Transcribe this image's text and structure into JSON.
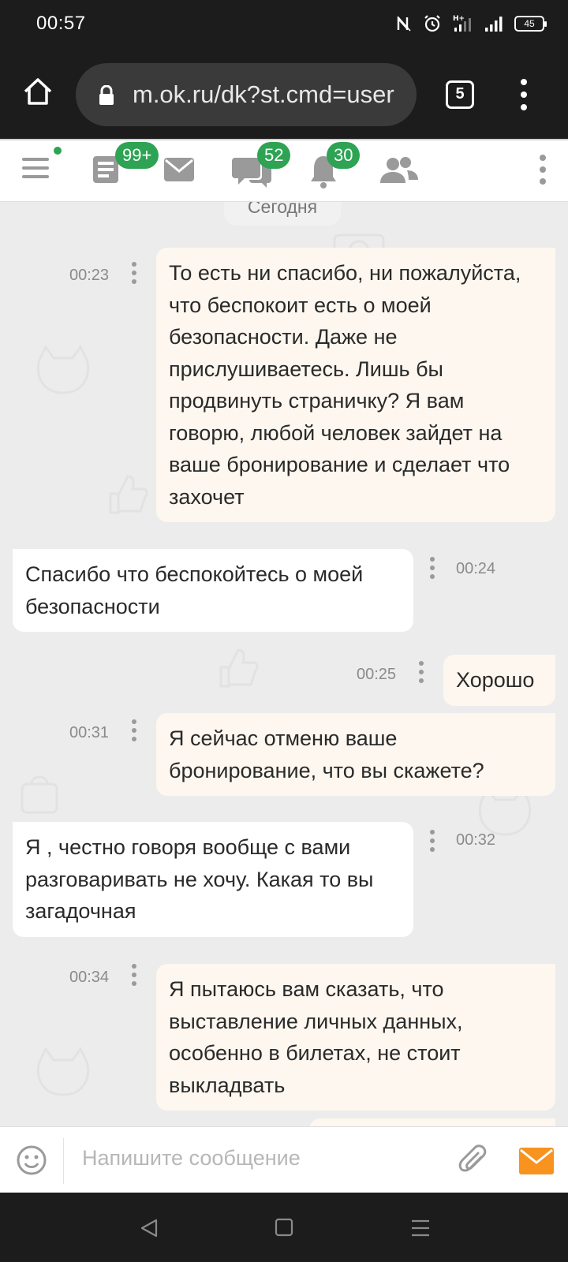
{
  "status_bar": {
    "time": "00:57",
    "battery": "45"
  },
  "browser": {
    "url": "m.ok.ru/dk?st.cmd=user",
    "tab_count": "5"
  },
  "header": {
    "badges": {
      "feed": "99+",
      "discussions": "52",
      "notifications": "30"
    }
  },
  "chat": {
    "date_label": "Сегодня",
    "messages": [
      {
        "direction": "out",
        "time": "00:23",
        "text": "То есть ни спасибо, ни пожалуйста, что беспокоит есть о моей безопасности. Даже не прислушиваетесь. Лишь бы продвинуть страничку? Я вам говорю, любой человек зайдет на ваше бронирование и сделает что захочет"
      },
      {
        "direction": "in",
        "time": "00:24",
        "text": "Спасибо что беспокойтесь о моей безопасности"
      },
      {
        "direction": "out",
        "time": "00:25",
        "text": "Хорошо"
      },
      {
        "direction": "out",
        "time": "00:31",
        "text": "Я сейчас отменю ваше бронирование, что вы скажете?"
      },
      {
        "direction": "in",
        "time": "00:32",
        "text": "Я , честно говоря вообще с вами разговаривать не хочу. Какая то вы загадочная"
      },
      {
        "direction": "out",
        "time": "00:34",
        "text": "Я пытаюсь вам сказать, что выставление личных данных, особенно в билетах, не стоит выкладвать"
      }
    ]
  },
  "composer": {
    "placeholder": "Напишите сообщение"
  },
  "colors": {
    "accent_green": "#2ea353",
    "send_orange": "#f7931e",
    "out_bubble": "#fdf7ef",
    "in_bubble": "#ffffff",
    "chat_bg": "#ececec"
  }
}
